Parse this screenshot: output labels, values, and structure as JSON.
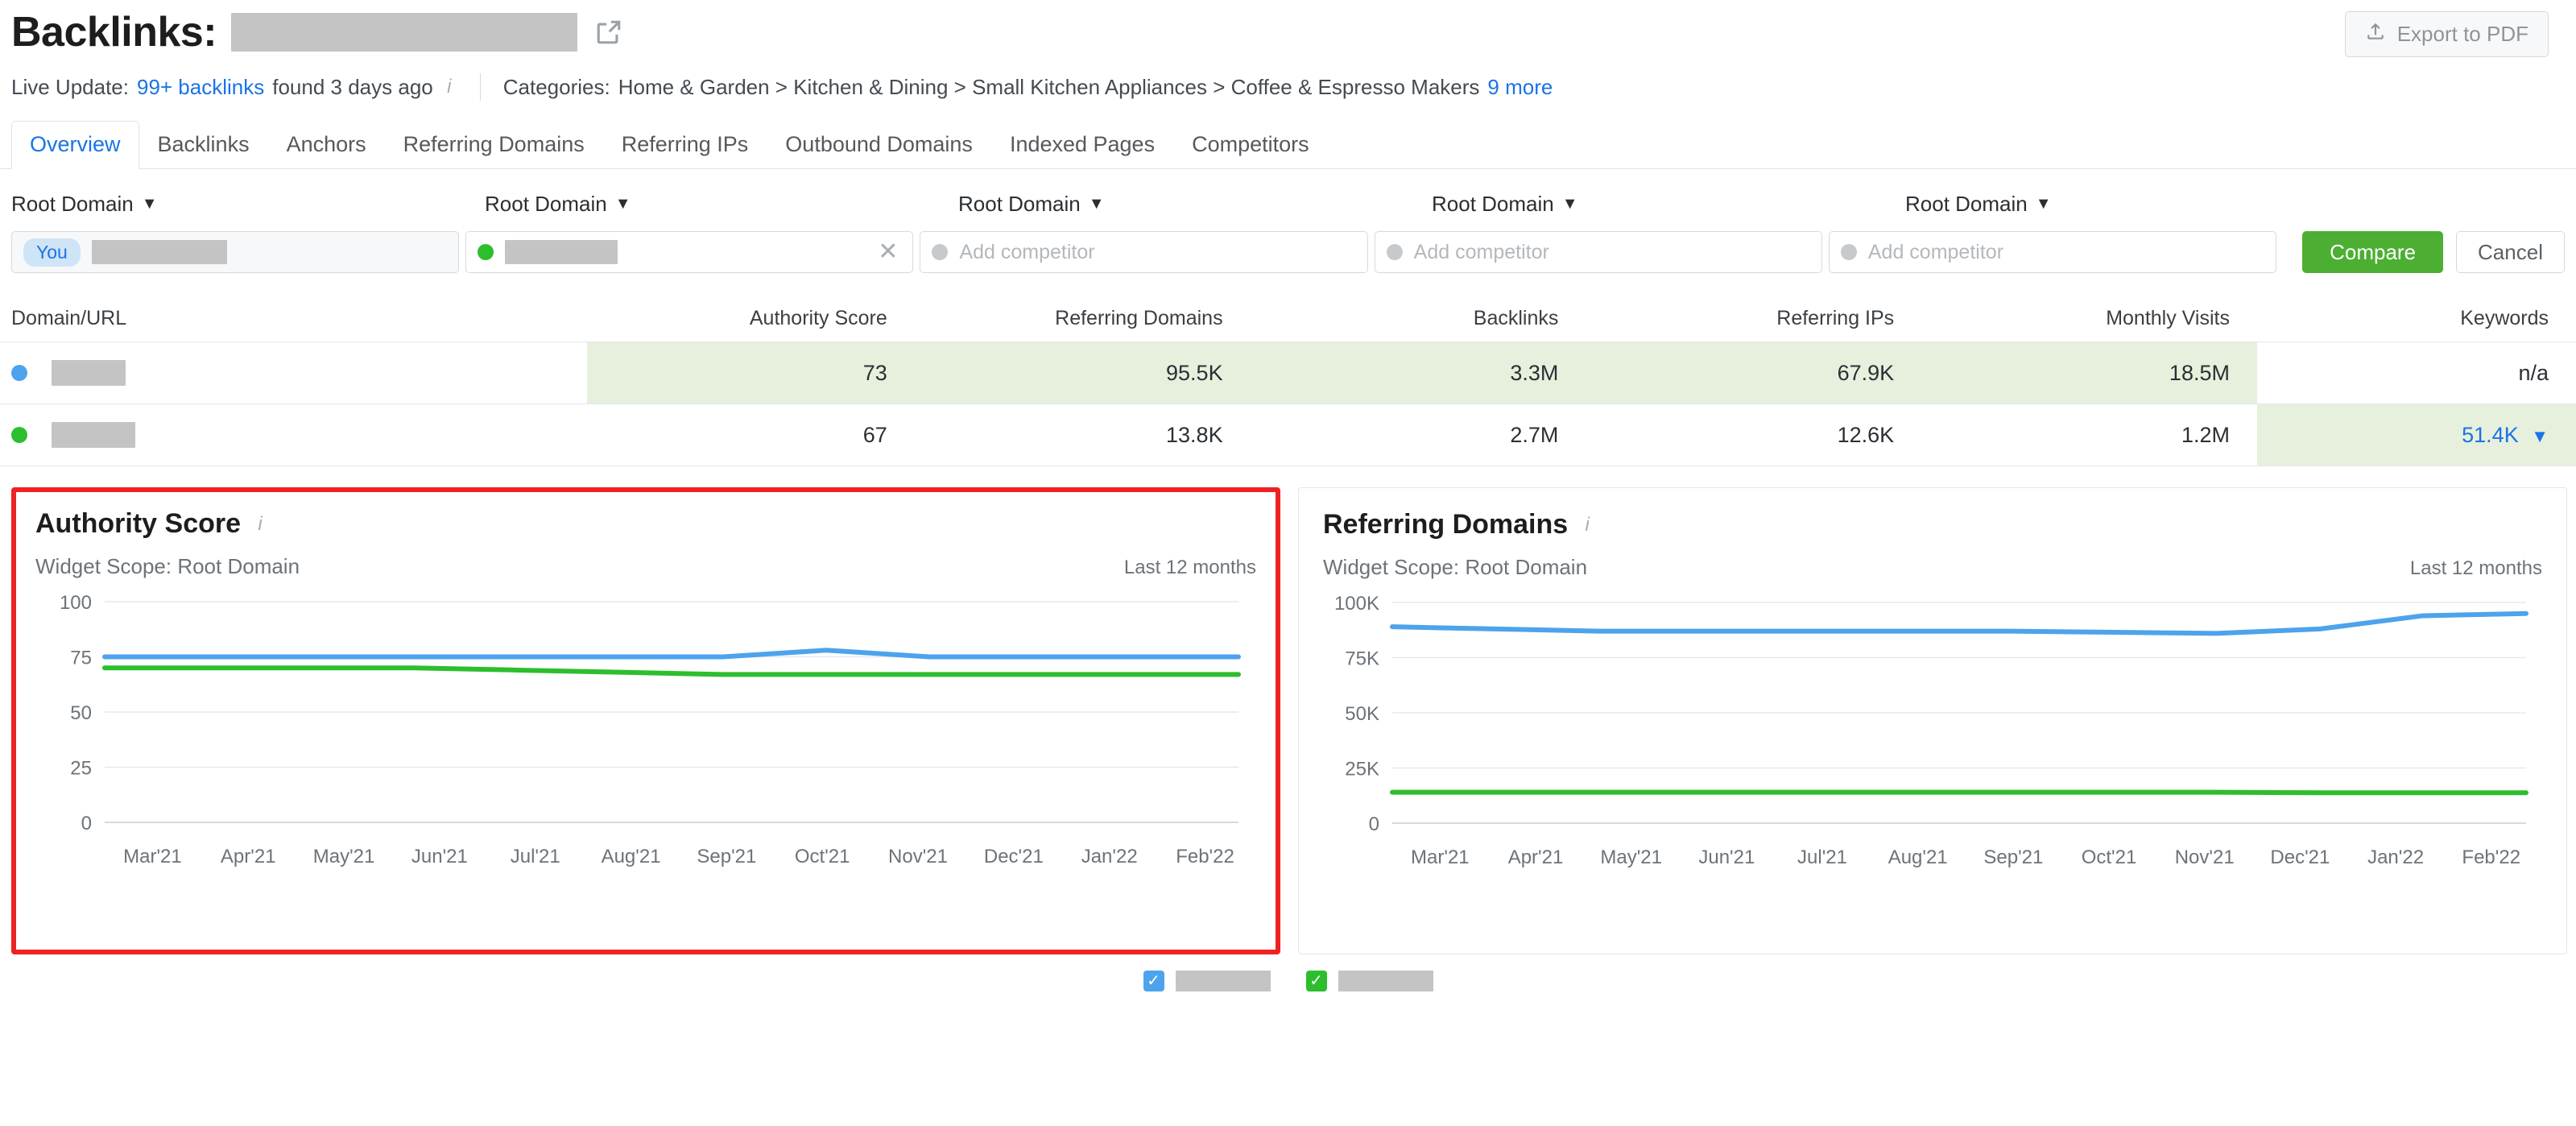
{
  "header": {
    "title": "Backlinks:",
    "domain_redacted": true,
    "external_link_icon": "external-link-icon",
    "export_label": "Export to PDF",
    "export_icon": "upload-icon"
  },
  "meta": {
    "live_update_prefix": "Live Update:",
    "live_update_link": "99+ backlinks",
    "live_update_suffix": "found 3 days ago",
    "info_icon": "info-icon",
    "categories_label": "Categories:",
    "categories_path": "Home & Garden > Kitchen & Dining > Small Kitchen Appliances > Coffee & Espresso Makers",
    "categories_more": "9 more"
  },
  "tabs": [
    {
      "label": "Overview",
      "active": true
    },
    {
      "label": "Backlinks",
      "active": false
    },
    {
      "label": "Anchors",
      "active": false
    },
    {
      "label": "Referring Domains",
      "active": false
    },
    {
      "label": "Referring IPs",
      "active": false
    },
    {
      "label": "Outbound Domains",
      "active": false
    },
    {
      "label": "Indexed Pages",
      "active": false
    },
    {
      "label": "Competitors",
      "active": false
    }
  ],
  "comparison": {
    "scope_label": "Root Domain",
    "slots": [
      {
        "type": "you",
        "badge": "You",
        "value_redacted": true
      },
      {
        "type": "competitor",
        "dot": "green",
        "value_redacted": true,
        "clear_icon": "close-icon"
      },
      {
        "type": "empty",
        "dot": "grey",
        "placeholder": "Add competitor"
      },
      {
        "type": "empty",
        "dot": "grey",
        "placeholder": "Add competitor"
      },
      {
        "type": "empty",
        "dot": "grey",
        "placeholder": "Add competitor"
      }
    ],
    "compare_label": "Compare",
    "cancel_label": "Cancel",
    "compare_color": "#4caf32"
  },
  "table": {
    "columns": [
      "Domain/URL",
      "Authority Score",
      "Referring Domains",
      "Backlinks",
      "Referring IPs",
      "Monthly Visits",
      "Keywords"
    ],
    "rows": [
      {
        "dot": "blue",
        "domain_redacted": true,
        "authority_score": "73",
        "referring_domains": "95.5K",
        "backlinks": "3.3M",
        "referring_ips": "67.9K",
        "monthly_visits": "18.5M",
        "keywords": "n/a",
        "highlight": [
          "authority_score",
          "referring_domains",
          "backlinks",
          "referring_ips",
          "monthly_visits"
        ]
      },
      {
        "dot": "green",
        "domain_redacted": true,
        "authority_score": "67",
        "referring_domains": "13.8K",
        "backlinks": "2.7M",
        "referring_ips": "12.6K",
        "monthly_visits": "1.2M",
        "keywords": "51.4K",
        "keywords_caret": "chevron-down-icon",
        "highlight": [
          "keywords"
        ]
      }
    ]
  },
  "widgets": [
    {
      "title": "Authority Score",
      "info_icon": "info-icon",
      "scope": "Widget Scope: Root Domain",
      "period": "Last 12 months",
      "highlighted": true,
      "highlight_color": "#ee2222"
    },
    {
      "title": "Referring Domains",
      "info_icon": "info-icon",
      "scope": "Widget Scope: Root Domain",
      "period": "Last 12 months",
      "highlighted": false
    }
  ],
  "legend": [
    {
      "color": "#4da3ec",
      "checked": true,
      "label_redacted": true
    },
    {
      "color": "#2dbe2d",
      "checked": true,
      "label_redacted": true
    }
  ],
  "chart_data": [
    {
      "type": "line",
      "title": "Authority Score",
      "subtitle": "Widget Scope: Root Domain",
      "period": "Last 12 months",
      "xlabel": "",
      "ylabel": "",
      "ylim": [
        0,
        100
      ],
      "yticks": [
        0,
        25,
        50,
        75,
        100
      ],
      "ytick_labels": [
        "0",
        "25",
        "50",
        "75",
        "100"
      ],
      "grid": true,
      "legend_position": "bottom-shared",
      "categories": [
        "Mar'21",
        "Apr'21",
        "May'21",
        "Jun'21",
        "Jul'21",
        "Aug'21",
        "Sep'21",
        "Oct'21",
        "Nov'21",
        "Dec'21",
        "Jan'22",
        "Feb'22"
      ],
      "series": [
        {
          "name": "you",
          "color": "#4da3ec",
          "values": [
            75,
            75,
            75,
            75,
            75,
            75,
            75,
            78,
            75,
            75,
            75,
            75
          ]
        },
        {
          "name": "competitor",
          "color": "#2dbe2d",
          "values": [
            70,
            70,
            70,
            70,
            69,
            68,
            67,
            67,
            67,
            67,
            67,
            67
          ]
        }
      ]
    },
    {
      "type": "line",
      "title": "Referring Domains",
      "subtitle": "Widget Scope: Root Domain",
      "period": "Last 12 months",
      "xlabel": "",
      "ylabel": "",
      "ylim": [
        0,
        100000
      ],
      "yticks": [
        0,
        25000,
        50000,
        75000,
        100000
      ],
      "ytick_labels": [
        "0",
        "25K",
        "50K",
        "75K",
        "100K"
      ],
      "grid": true,
      "legend_position": "bottom-shared",
      "categories": [
        "Mar'21",
        "Apr'21",
        "May'21",
        "Jun'21",
        "Jul'21",
        "Aug'21",
        "Sep'21",
        "Oct'21",
        "Nov'21",
        "Dec'21",
        "Jan'22",
        "Feb'22"
      ],
      "series": [
        {
          "name": "you",
          "color": "#4da3ec",
          "values": [
            89000,
            88000,
            87000,
            87000,
            87000,
            87000,
            87000,
            86500,
            86000,
            88000,
            94000,
            95000
          ]
        },
        {
          "name": "competitor",
          "color": "#2dbe2d",
          "values": [
            14000,
            14000,
            14000,
            14000,
            14000,
            14000,
            14000,
            14000,
            14000,
            13800,
            13800,
            13800
          ]
        }
      ]
    }
  ]
}
